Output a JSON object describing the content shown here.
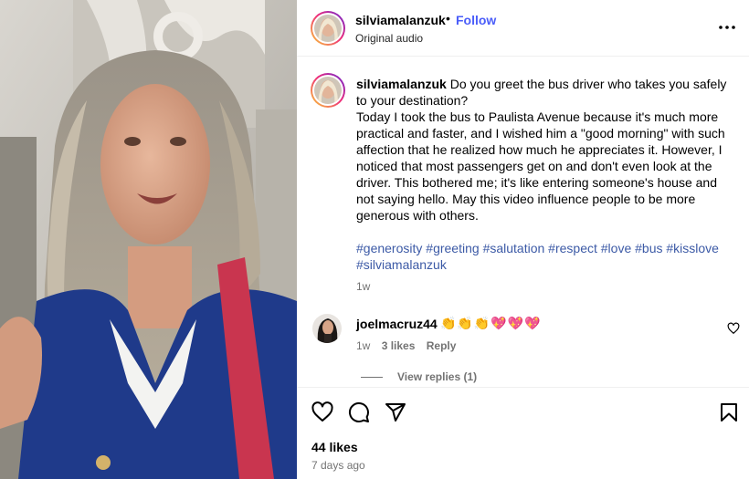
{
  "post": {
    "username": "silviamalanzuk",
    "separator": "•",
    "follow_label": "Follow",
    "audio_label": "Original audio"
  },
  "caption": {
    "username": "silviamalanzuk",
    "text": "Do you greet the bus driver who takes you safely to your destination?\nToday I took the bus to Paulista Avenue because it's much more practical and faster, and I wished him a \"good morning\" with such affection that he realized how much he appreciates it. However, I noticed that most passengers get on and don't even look at the driver. This bothered me; it's like entering someone's house and not saying hello. May this video influence people to be more generous with others.",
    "hashtags": [
      "#generosity",
      "#greeting",
      "#salutation",
      "#respect",
      "#love",
      "#bus",
      "#kisslove",
      "#silviamalanzuk"
    ],
    "time": "1w"
  },
  "comment": {
    "username": "joelmacruz44",
    "text": "👏👏👏💖💖💖",
    "time": "1w",
    "likes": "3 likes",
    "reply_label": "Reply",
    "view_replies": "View replies (1)"
  },
  "footer": {
    "likes": "44 likes",
    "date": "7 days ago"
  },
  "icons": {
    "more": "more-options-icon",
    "like": "heart-icon",
    "comment": "comment-icon",
    "share": "share-icon",
    "save": "bookmark-icon"
  },
  "colors": {
    "follow": "#4a5df9",
    "hashtag": "#3c5aa6",
    "muted": "#737373"
  }
}
